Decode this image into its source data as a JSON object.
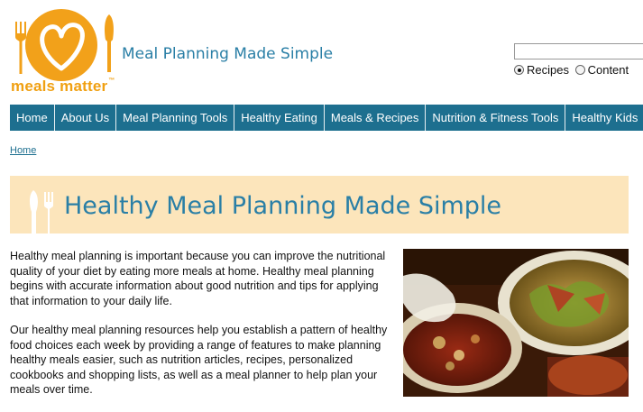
{
  "header": {
    "logo_text": "meals matter",
    "logo_tm": "™",
    "tagline": "Meal Planning Made Simple"
  },
  "search": {
    "value": "",
    "placeholder": "",
    "options": [
      {
        "label": "Recipes",
        "selected": true
      },
      {
        "label": "Content",
        "selected": false
      }
    ]
  },
  "nav": {
    "items": [
      "Home",
      "About Us",
      "Meal Planning Tools",
      "Healthy Eating",
      "Meals & Recipes",
      "Nutrition & Fitness Tools",
      "Healthy Kids"
    ]
  },
  "breadcrumb": {
    "home": "Home"
  },
  "banner": {
    "title": "Healthy Meal Planning Made Simple"
  },
  "main": {
    "paragraphs": [
      "Healthy meal planning is important because you can improve the nutritional quality of your diet by eating more meals at home. Healthy meal planning begins with accurate information about good nutrition and tips for applying that information to your daily life.",
      "Our healthy meal planning resources help you establish a pattern of healthy food choices each week by providing a range of features to make planning healthy meals easier, such as nutrition articles, recipes, personalized cookbooks and shopping lists, as well as a meal planner to help plan your meals over time."
    ]
  },
  "colors": {
    "brand_orange": "#f2a11a",
    "nav_blue": "#1d6f8f",
    "heading_blue": "#2a7fa6",
    "banner_bg": "#fce5bb"
  }
}
